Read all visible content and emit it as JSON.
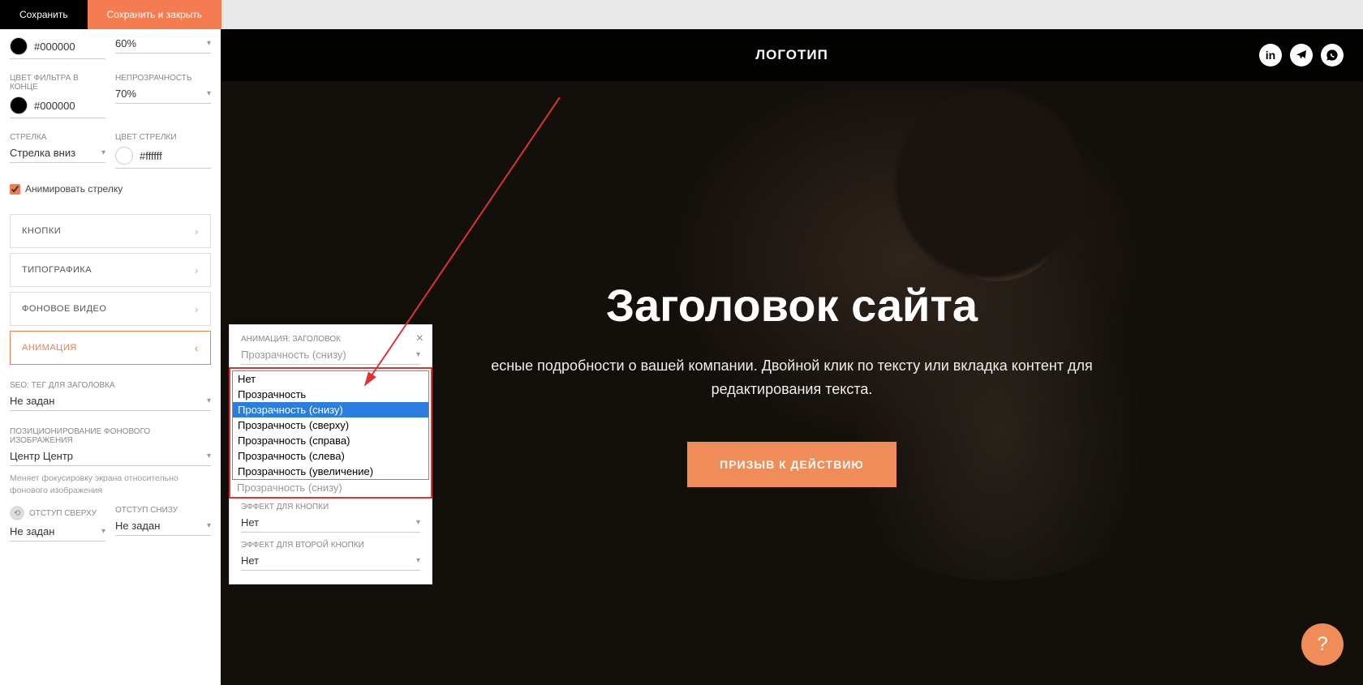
{
  "topbar": {
    "save": "Сохранить",
    "saveClose": "Сохранить и закрыть"
  },
  "sidebar": {
    "filterStartColor": "#000000",
    "opacity1Label": "",
    "opacity1": "60%",
    "filterEndLabel": "ЦВЕТ ФИЛЬТРА В КОНЦЕ",
    "filterEndColor": "#000000",
    "opacity2Label": "НЕПРОЗРАЧНОСТЬ",
    "opacity2": "70%",
    "arrowLabel": "СТРЕЛКА",
    "arrowValue": "Стрелка вниз",
    "arrowColorLabel": "ЦВЕТ СТРЕЛКИ",
    "arrowColorValue": "#ffffff",
    "animateArrow": "Анимировать стрелку",
    "panels": {
      "buttons": "КНОПКИ",
      "typography": "ТИПОГРАФИКА",
      "bgvideo": "ФОНОВОЕ ВИДЕО",
      "animation": "АНИМАЦИЯ"
    },
    "seoLabel": "SEO: ТЕГ ДЛЯ ЗАГОЛОВКА",
    "seoValue": "Не задан",
    "posLabel": "ПОЗИЦИОНИРОВАНИЕ ФОНОВОГО ИЗОБРАЖЕНИЯ",
    "posValue": "Центр Центр",
    "posHint": "Меняет фокусировку экрана относительно фонового изображения",
    "padTopLabel": "ОТСТУП СВЕРХУ",
    "padTopValue": "Не задан",
    "padBotLabel": "ОТСТУП СНИЗУ",
    "padBotValue": "Не задан"
  },
  "popup": {
    "title": "АНИМАЦИЯ: ЗАГОЛОВОК",
    "headingValue": "Прозрачность (снизу)",
    "subtextAfter": "Прозрачность (снизу)",
    "btnLabel": "ЭФФЕКТ ДЛЯ КНОПКИ",
    "btnValue": "Нет",
    "btn2Label": "ЭФФЕКТ ДЛЯ ВТОРОЙ КНОПКИ",
    "btn2Value": "Нет"
  },
  "dropdown": {
    "options": [
      "Нет",
      "Прозрачность",
      "Прозрачность (снизу)",
      "Прозрачность (сверху)",
      "Прозрачность (справа)",
      "Прозрачность (слева)",
      "Прозрачность (увеличение)"
    ],
    "selectedIndex": 2
  },
  "hero": {
    "logo": "ЛОГОТИП",
    "title": "Заголовок  сайта",
    "subtitle": "есные подробности о вашей компании. Двойной клик по тексту или вкладка контент   для редактирования текста.",
    "cta": "ПРИЗЫВ К ДЕЙСТВИЮ"
  },
  "help": "?"
}
